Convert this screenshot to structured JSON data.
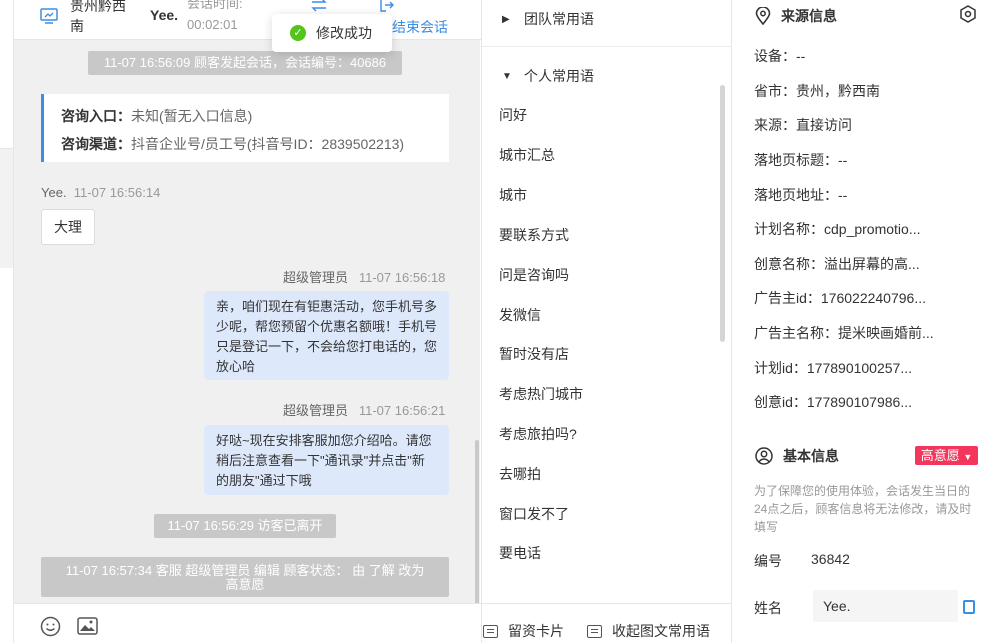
{
  "header": {
    "location": "贵州黔西南",
    "customer": "Yee.",
    "session_time_label": "会话时间:",
    "session_time": "00:02:01",
    "end_session": "结束会话"
  },
  "toast": {
    "text": "修改成功"
  },
  "chat": {
    "system_start": "11-07 16:56:09 顾客发起会话，会话编号：40686",
    "entry_label": "咨询入口：",
    "entry_value": "未知(暂无入口信息)",
    "channel_label": "咨询渠道：",
    "channel_value": "抖音企业号/员工号(抖音号ID：2839502213)",
    "m1_sender": "Yee.",
    "m1_time": "11-07 16:56:14",
    "m1_text": "大理",
    "m2_sender": "超级管理员",
    "m2_time": "11-07 16:56:18",
    "m2_text": "亲，咱们现在有钜惠活动，您手机号多少呢，帮您预留个优惠名额哦！手机号只是登记一下，不会给您打电话的，您放心哈",
    "m3_sender": "超级管理员",
    "m3_time": "11-07 16:56:21",
    "m3_text": "好哒~现在安排客服加您介绍哈。请您稍后注意查看一下\"通讯录\"并点击\"新的朋友\"通过下哦",
    "system_left": "11-07 16:56:29 访客已离开",
    "system_edit": "11-07 16:57:34 客服 超级管理员 编辑 顾客状态： 由 了解 改为 高意愿"
  },
  "phrases": {
    "team_group": "团队常用语",
    "personal_group": "个人常用语",
    "items": [
      "问好",
      "城市汇总",
      "城市",
      "要联系方式",
      "问是咨询吗",
      "发微信",
      "暂时没有店",
      "考虑热门城市",
      "考虑旅拍吗?",
      "去哪拍",
      "窗口发不了",
      "要电话"
    ],
    "card_button": "留资卡片",
    "collapse_button": "收起图文常用语"
  },
  "source": {
    "title": "来源信息",
    "rows": [
      "设备：--",
      "省市：贵州，黔西南",
      "来源：直接访问",
      "落地页标题：--",
      "落地页地址：--",
      "计划名称：cdp_promotio...",
      "创意名称：溢出屏幕的高...",
      "广告主id：176022240796...",
      "广告主名称：提米映画婚前...",
      "计划id：177890100257...",
      "创意id：177890107986..."
    ]
  },
  "basic": {
    "title": "基本信息",
    "badge": "高意愿",
    "note": "为了保障您的使用体验，会话发生当日的24点之后，顾客信息将无法修改，请及时填写",
    "id_label": "编号",
    "id_value": "36842",
    "name_label": "姓名",
    "name_value": "Yee."
  },
  "colors": {
    "accent": "#3a8ee6",
    "badge": "#f5365c",
    "bubble": "#dde9fb",
    "success": "#52c41a"
  }
}
